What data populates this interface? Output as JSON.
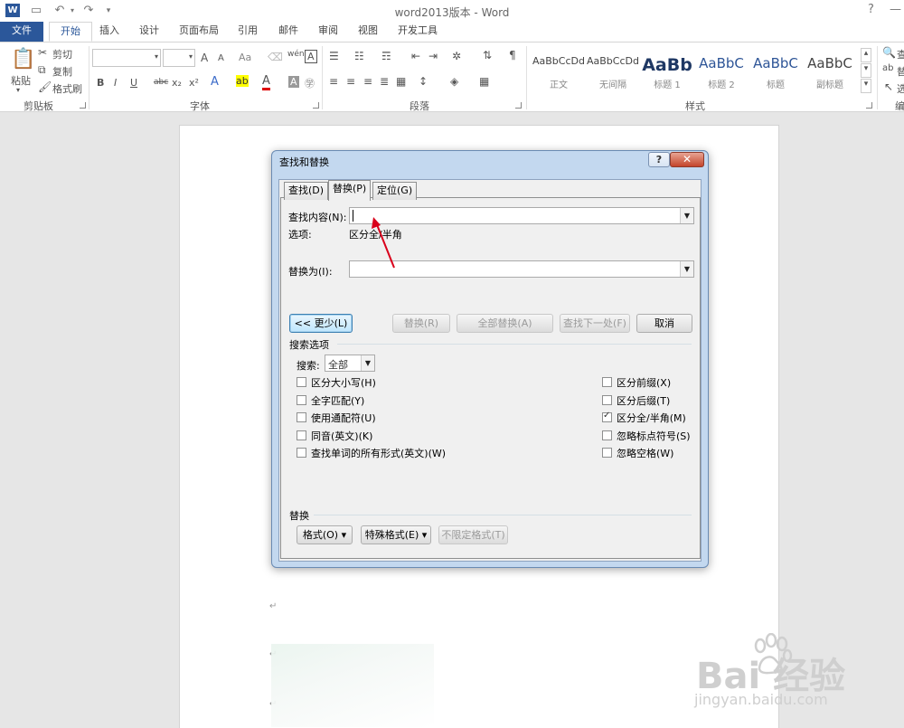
{
  "window": {
    "title": "word2013版本 - Word",
    "app_icon": "W",
    "help_glyph": "?",
    "minimize_glyph": "—"
  },
  "tabs": {
    "file": "文件",
    "items": [
      "开始",
      "插入",
      "设计",
      "页面布局",
      "引用",
      "邮件",
      "审阅",
      "视图",
      "开发工具"
    ]
  },
  "ribbon": {
    "clipboard": {
      "paste": "粘贴",
      "cut": "剪切",
      "copy": "复制",
      "format_painter": "格式刷",
      "label": "剪贴板"
    },
    "font": {
      "label": "字体",
      "grow": "A",
      "shrink": "A",
      "case": "Aa",
      "bold": "B",
      "italic": "I",
      "underline": "U",
      "strike": "abc",
      "sub": "x₂",
      "sup": "x²",
      "wen": "wén",
      "char_border": "A",
      "effects": "A",
      "font_color": "A",
      "shade": "A",
      "enclose": "㊫"
    },
    "paragraph": {
      "label": "段落"
    },
    "styles": {
      "label": "样式",
      "items": [
        {
          "sample": "AaBbCcDd",
          "name": "正文"
        },
        {
          "sample": "AaBbCcDd",
          "name": "无间隔"
        },
        {
          "sample": "AaBb",
          "name": "标题 1"
        },
        {
          "sample": "AaBbC",
          "name": "标题 2"
        },
        {
          "sample": "AaBbC",
          "name": "标题"
        },
        {
          "sample": "AaBbC",
          "name": "副标题"
        }
      ]
    },
    "editing": {
      "find": "查",
      "replace": "替",
      "select": "选",
      "label": "编"
    }
  },
  "dialog": {
    "title": "查找和替换",
    "help": "?",
    "close": "✕",
    "tabs": [
      "查找(D)",
      "替换(P)",
      "定位(G)"
    ],
    "find_label": "查找内容(N):",
    "find_value": "",
    "options_label": "选项:",
    "options_value": "区分全/半角",
    "replace_label": "替换为(I):",
    "replace_value": "",
    "buttons": {
      "less": "<< 更少(L)",
      "replace": "替换(R)",
      "replace_all": "全部替换(A)",
      "find_next": "查找下一处(F)",
      "cancel": "取消"
    },
    "search_options_title": "搜索选项",
    "search_label": "搜索:",
    "search_value": "全部",
    "left_options": [
      {
        "label": "区分大小写(H)",
        "checked": false
      },
      {
        "label": "全字匹配(Y)",
        "checked": false
      },
      {
        "label": "使用通配符(U)",
        "checked": false
      },
      {
        "label": "同音(英文)(K)",
        "checked": false
      },
      {
        "label": "查找单词的所有形式(英文)(W)",
        "checked": false
      }
    ],
    "right_options": [
      {
        "label": "区分前缀(X)",
        "checked": false
      },
      {
        "label": "区分后缀(T)",
        "checked": false
      },
      {
        "label": "区分全/半角(M)",
        "checked": true
      },
      {
        "label": "忽略标点符号(S)",
        "checked": false
      },
      {
        "label": "忽略空格(W)",
        "checked": false
      }
    ],
    "replace_section_title": "替换",
    "format_button": "格式(O) ▾",
    "special_button": "特殊格式(E) ▾",
    "no_format_button": "不限定格式(T)"
  },
  "document": {
    "para_mark": "↵"
  },
  "watermark": {
    "brand": "Bai  经验",
    "url": "jingyan.baidu.com"
  },
  "colors": {
    "accent": "#2b579a",
    "annotation_arrow": "#d9001b"
  }
}
